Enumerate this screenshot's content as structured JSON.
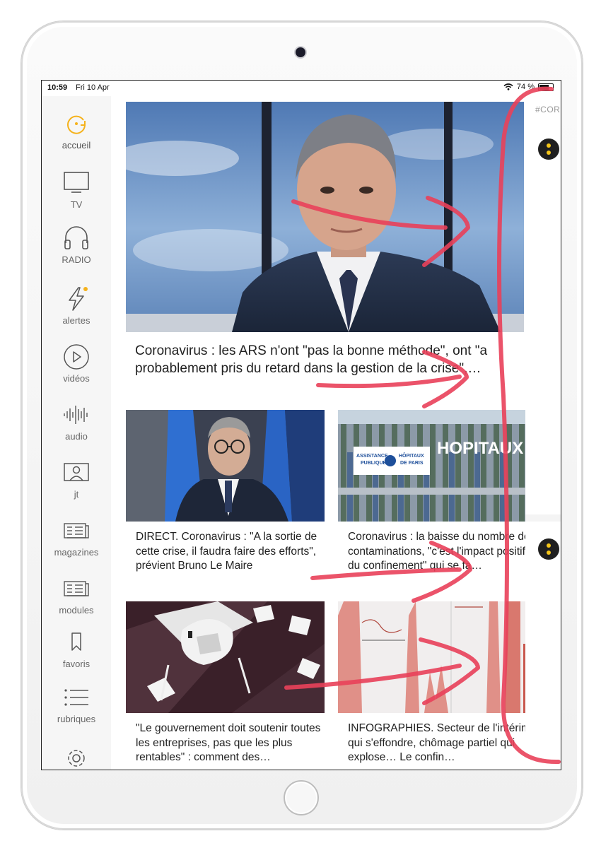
{
  "status_bar": {
    "time": "10:59",
    "date": "Fri 10 Apr",
    "battery_text": "74 %",
    "battery_level_percent": 74
  },
  "sidebar": {
    "items": [
      {
        "label": "accueil",
        "icon": "home-refresh-icon",
        "active": true
      },
      {
        "label": "TV",
        "icon": "tv-icon"
      },
      {
        "label": "RADIO",
        "icon": "headphones-icon"
      },
      {
        "label": "alertes",
        "icon": "bolt-icon",
        "badge": true
      },
      {
        "label": "vidéos",
        "icon": "play-icon"
      },
      {
        "label": "audio",
        "icon": "waveform-icon"
      },
      {
        "label": "jt",
        "icon": "presenter-icon"
      },
      {
        "label": "magazines",
        "icon": "magazine-icon"
      },
      {
        "label": "modules",
        "icon": "modules-icon"
      },
      {
        "label": "favoris",
        "icon": "bookmark-icon"
      },
      {
        "label": "rubriques",
        "icon": "list-icon"
      },
      {
        "label": "",
        "icon": "gear-icon"
      }
    ]
  },
  "main": {
    "hero": {
      "headline": "Coronavirus : les ARS n'ont \"pas la bonne méthode\", ont \"a probablement pris du retard dans la gestion de la crise\",…"
    },
    "cards": [
      {
        "headline": "DIRECT. Coronavirus : \"A la sortie de cette crise, il faudra faire des efforts\", prévient Bruno Le Maire"
      },
      {
        "headline": "Coronavirus : la baisse du nombre de contaminations, \"c'est l'impact positif du confinement\" qui se fa…",
        "image_sign": {
          "line1": "ASSISTANCE",
          "line2": "PUBLIQUE",
          "line3": "HÔPITAUX",
          "line4": "DE PARIS",
          "big": "HOPITAUX"
        }
      },
      {
        "headline": "\"Le gouvernement doit soutenir toutes les entreprises, pas que les plus rentables\" : comment des…"
      },
      {
        "headline": "INFOGRAPHIES. Secteur de l'intérim qui s'effondre, chômage partiel qui explose… Le confin…"
      }
    ]
  },
  "right_strip": {
    "hashtag": "#COR"
  },
  "colors": {
    "accent": "#f5b21b",
    "annotation_ink": "#e9415a",
    "sidebar_bg": "#f6f6f6"
  }
}
